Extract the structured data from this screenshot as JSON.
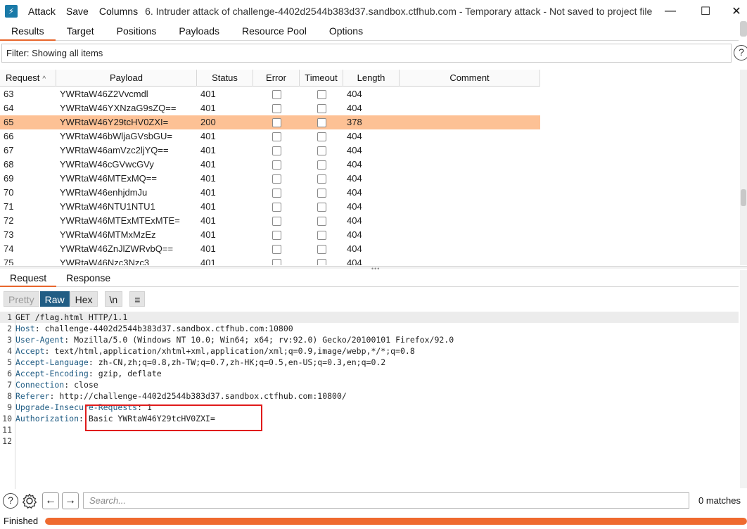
{
  "titlebar": {
    "menu": [
      "Attack",
      "Save",
      "Columns"
    ],
    "window_title": "6. Intruder attack of challenge-4402d2544b383d37.sandbox.ctfhub.com - Temporary attack - Not saved to project file",
    "minimize": "—",
    "maximize": "☐",
    "close": "✕"
  },
  "main_tabs": [
    "Results",
    "Target",
    "Positions",
    "Payloads",
    "Resource Pool",
    "Options"
  ],
  "filter": {
    "text": "Filter: Showing all items"
  },
  "help_label": "?",
  "table": {
    "columns": [
      "Request",
      "Payload",
      "Status",
      "Error",
      "Timeout",
      "Length",
      "Comment"
    ],
    "sort_indicator": "^",
    "selected_request": "65",
    "rows": [
      {
        "request": "63",
        "payload": "YWRtaW46Z2Vvcmdl",
        "status": "401",
        "length": "404"
      },
      {
        "request": "64",
        "payload": "YWRtaW46YXNzaG9sZQ==",
        "status": "401",
        "length": "404"
      },
      {
        "request": "65",
        "payload": "YWRtaW46Y29tcHV0ZXI=",
        "status": "200",
        "length": "378"
      },
      {
        "request": "66",
        "payload": "YWRtaW46bWljaGVsbGU=",
        "status": "401",
        "length": "404"
      },
      {
        "request": "67",
        "payload": "YWRtaW46amVzc2ljYQ==",
        "status": "401",
        "length": "404"
      },
      {
        "request": "68",
        "payload": "YWRtaW46cGVwcGVy",
        "status": "401",
        "length": "404"
      },
      {
        "request": "69",
        "payload": "YWRtaW46MTExMQ==",
        "status": "401",
        "length": "404"
      },
      {
        "request": "70",
        "payload": "YWRtaW46enhjdmJu",
        "status": "401",
        "length": "404"
      },
      {
        "request": "71",
        "payload": "YWRtaW46NTU1NTU1",
        "status": "401",
        "length": "404"
      },
      {
        "request": "72",
        "payload": "YWRtaW46MTExMTExMTE=",
        "status": "401",
        "length": "404"
      },
      {
        "request": "73",
        "payload": "YWRtaW46MTMxMzEz",
        "status": "401",
        "length": "404"
      },
      {
        "request": "74",
        "payload": "YWRtaW46ZnJlZWRvbQ==",
        "status": "401",
        "length": "404"
      },
      {
        "request": "75",
        "payload": "YWRtaW46Nzc3Nzc3",
        "status": "401",
        "length": "404"
      }
    ]
  },
  "viewer_tabs": [
    "Request",
    "Response"
  ],
  "format_buttons": {
    "pretty": "Pretty",
    "raw": "Raw",
    "hex": "Hex",
    "newline": "\\n",
    "menu": "≡"
  },
  "request_lines": [
    {
      "num": "1",
      "key": "",
      "value": "GET /flag.html HTTP/1.1"
    },
    {
      "num": "2",
      "key": "Host",
      "value": " challenge-4402d2544b383d37.sandbox.ctfhub.com:10800"
    },
    {
      "num": "3",
      "key": "User-Agent",
      "value": " Mozilla/5.0 (Windows NT 10.0; Win64; x64; rv:92.0) Gecko/20100101 Firefox/92.0"
    },
    {
      "num": "4",
      "key": "Accept",
      "value": " text/html,application/xhtml+xml,application/xml;q=0.9,image/webp,*/*;q=0.8"
    },
    {
      "num": "5",
      "key": "Accept-Language",
      "value": " zh-CN,zh;q=0.8,zh-TW;q=0.7,zh-HK;q=0.5,en-US;q=0.3,en;q=0.2"
    },
    {
      "num": "6",
      "key": "Accept-Encoding",
      "value": " gzip, deflate"
    },
    {
      "num": "7",
      "key": "Connection",
      "value": " close"
    },
    {
      "num": "8",
      "key": "Referer",
      "value": " http://challenge-4402d2544b383d37.sandbox.ctfhub.com:10800/"
    },
    {
      "num": "9",
      "key": "Upgrade-Insecure-Requests",
      "value": " 1"
    },
    {
      "num": "10",
      "key": "Authorization",
      "value": " Basic YWRtaW46Y29tcHV0ZXI="
    },
    {
      "num": "11",
      "key": "",
      "value": ""
    },
    {
      "num": "12",
      "key": "",
      "value": ""
    }
  ],
  "search": {
    "placeholder": "Search...",
    "matches": "0 matches",
    "prev": "←",
    "next": "→"
  },
  "status": {
    "text": "Finished",
    "progress_fraction": 1.0
  },
  "colors": {
    "accent": "#e8662c",
    "selected_row": "#fdc195",
    "raw_active": "#215d84",
    "highlight_box": "#e01b1b"
  }
}
